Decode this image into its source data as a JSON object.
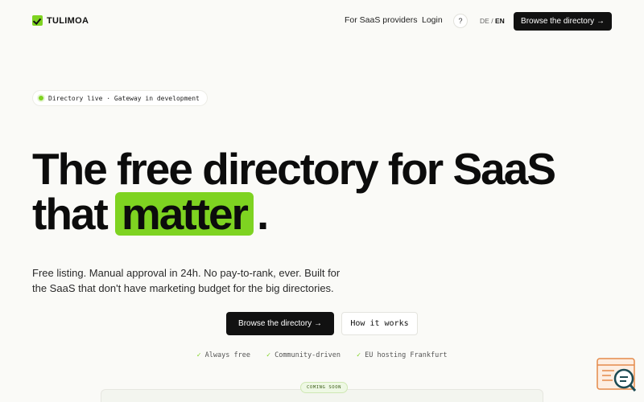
{
  "header": {
    "logo_text": "TULIMOA",
    "nav": {
      "providers": "For SaaS providers",
      "login": "Login",
      "help": "?"
    },
    "lang": {
      "de": "DE",
      "sep": "/",
      "en": "EN"
    },
    "cta": "Browse the directory →"
  },
  "status": {
    "text": "Directory live · Gateway in development"
  },
  "hero": {
    "line1": "The free directory for SaaS",
    "line2_pre": "that",
    "line2_highlight": "matter",
    "line2_post": ".",
    "lead": "Free listing. Manual approval in 24h. No pay-to-rank, ever. Built for the SaaS that don't have marketing budget for the big directories.",
    "cta_primary": "Browse the directory →",
    "cta_secondary": "How it works"
  },
  "features": [
    {
      "check": "✓",
      "label": "Always free"
    },
    {
      "check": "✓",
      "label": "Community-driven"
    },
    {
      "check": "✓",
      "label": "EU hosting Frankfurt"
    }
  ],
  "preview": {
    "badge": "COMING SOON"
  },
  "colors": {
    "accent": "#7ed321",
    "dark": "#111111",
    "background": "#fafaf7"
  }
}
